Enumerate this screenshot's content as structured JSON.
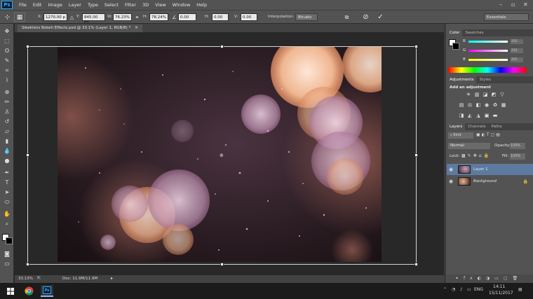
{
  "menu": {
    "logo": "Ps",
    "items": [
      "File",
      "Edit",
      "Image",
      "Layer",
      "Type",
      "Select",
      "Filter",
      "3D",
      "View",
      "Window",
      "Help"
    ]
  },
  "options": {
    "x_label": "X:",
    "x_value": "1270.00 p",
    "y_label": "Y:",
    "y_value": "845.00 px",
    "w_label": "W:",
    "w_value": "76.23%",
    "h_label": "H:",
    "h_value": "78.24%",
    "angle_value": "0.00",
    "hskew_label": "H:",
    "hskew_value": "0.00",
    "vskew_label": "V:",
    "vskew_value": "0.00",
    "interp_label": "Interpolation:",
    "interp_value": "Bicubic",
    "workspace": "Essentials"
  },
  "document": {
    "tab_title": "Sleeklens Bokeh Effects.psd @ 33.1% (Layer 1, RGB/8) *",
    "zoom": "33.13%",
    "doc_size": "Doc: 11.9M/11.9M"
  },
  "panels": {
    "color_tabs": [
      "Color",
      "Swatches"
    ],
    "channels": [
      {
        "label": "R",
        "value": "255"
      },
      {
        "label": "G",
        "value": "255"
      },
      {
        "label": "B",
        "value": "255"
      }
    ],
    "adjust_tabs": [
      "Adjustments",
      "Styles"
    ],
    "adjust_title": "Add an adjustment",
    "layer_tabs": [
      "Layers",
      "Channels",
      "Paths"
    ],
    "kind_label": "Kind",
    "blend_mode": "Normal",
    "opacity_label": "Opacity:",
    "opacity_value": "100%",
    "lock_label": "Lock:",
    "fill_label": "Fill:",
    "fill_value": "100%",
    "layers": [
      {
        "name": "Layer 1",
        "selected": true
      },
      {
        "name": "Background",
        "selected": false
      }
    ]
  },
  "taskbar": {
    "lang": "ENG",
    "time": "14:11",
    "date": "15/11/2017"
  },
  "colors": {
    "accent": "#31a8ff",
    "panel": "#535353",
    "selected_layer": "#5d7aa0"
  }
}
